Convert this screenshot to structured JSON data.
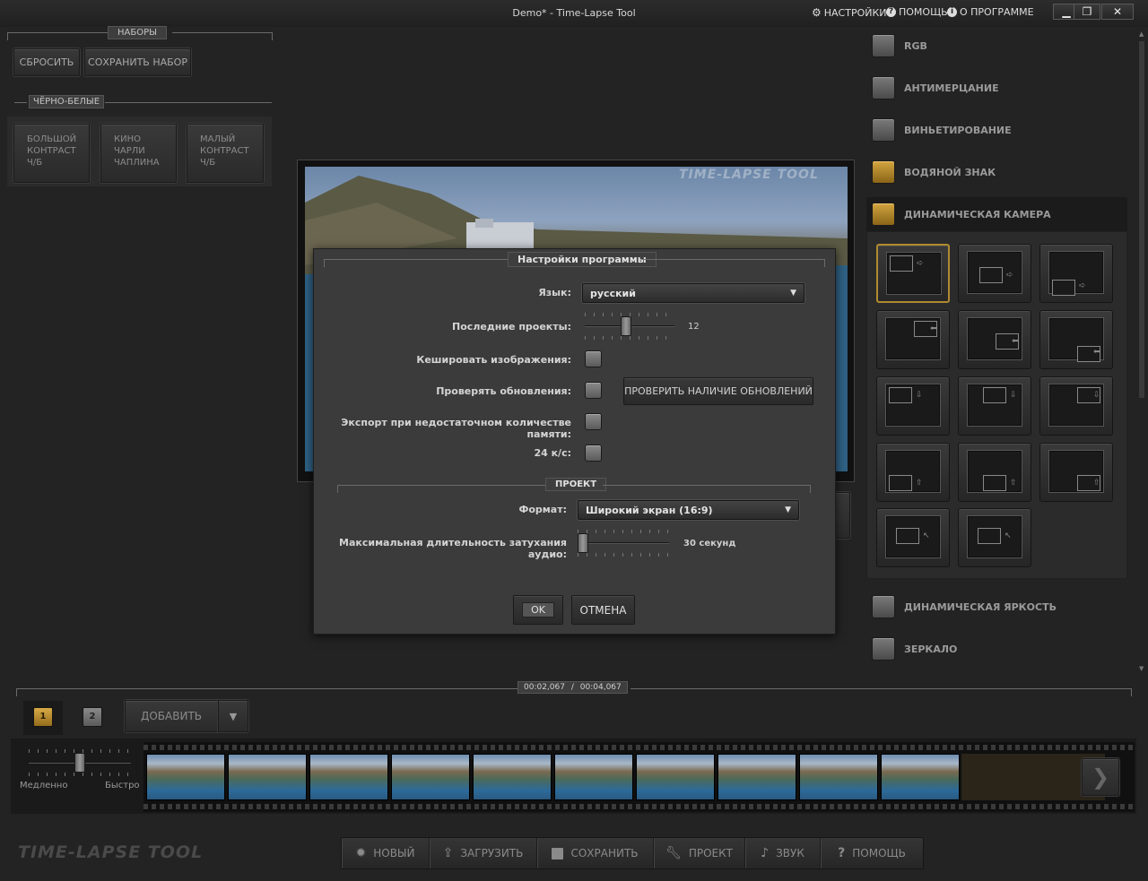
{
  "window": {
    "title": "Demo* - Time-Lapse Tool",
    "menu": {
      "settings": "НАСТРОЙКИ",
      "help": "ПОМОЩЬ",
      "about": "О ПРОГРАММЕ"
    },
    "controls": {
      "minimize": "▁",
      "restore": "❐",
      "close": "✕"
    }
  },
  "presets": {
    "heading": "НАБОРЫ",
    "reset_label": "СБРОСИТЬ",
    "save_label": "СОХРАНИТЬ НАБОР",
    "bw_heading": "ЧЁРНО-БЕЛЫЕ",
    "items": [
      {
        "label": "БОЛЬШОЙ\nКОНТРАСТ\nЧ/Б"
      },
      {
        "label": "КИНО\nЧАРЛИ\nЧАПЛИНА"
      },
      {
        "label": "МАЛЫЙ\nКОНТРАСТ\nЧ/Б"
      }
    ]
  },
  "preview": {
    "watermark": "TIME-LAPSE TOOL"
  },
  "effects": {
    "items": [
      {
        "label": "RGB",
        "on": false
      },
      {
        "label": "АНТИМЕРЦАНИЕ",
        "on": false
      },
      {
        "label": "ВИНЬЕТИРОВАНИЕ",
        "on": false
      },
      {
        "label": "ВОДЯНОЙ ЗНАК",
        "on": true
      },
      {
        "label": "ДИНАМИЧЕСКАЯ КАМЕРА",
        "on": true
      }
    ],
    "bottom_items": [
      {
        "label": "ДИНАМИЧЕСКАЯ ЯРКОСТЬ",
        "on": false
      },
      {
        "label": "ЗЕРКАЛО",
        "on": false
      }
    ],
    "camera_selected": 0
  },
  "dialog": {
    "title": "Настройки программы",
    "language_label": "Язык:",
    "language_value": "русский",
    "recent_label": "Последние проекты:",
    "recent_value": "12",
    "recent_fraction": 0.45,
    "cache_label": "Кешировать изображения:",
    "updates_label": "Проверять обновления:",
    "check_updates_button": "ПРОВЕРИТЬ НАЛИЧИЕ ОБНОВЛЕНИЙ",
    "lowmem_label": "Экспорт при недостаточном количестве памяти:",
    "fps_label": "24 к/с:",
    "project_heading": "ПРОЕКТ",
    "format_label": "Формат:",
    "format_value": "Широкий экран (16:9)",
    "fade_label": "Максимальная длительность затухания аудио:",
    "fade_value": "30 секунд",
    "fade_fraction": 0.0,
    "ok_label": "OK",
    "cancel_label": "ОТМЕНА"
  },
  "timeline": {
    "current_time": "00:02,067",
    "separator": "/",
    "total_time": "00:04,067",
    "pages": [
      "1",
      "2"
    ],
    "active_page": 0,
    "add_label": "ДОБАВИТЬ",
    "speed_slow": "Медленно",
    "speed_fast": "Быстро",
    "speed_fraction": 0.5,
    "frame_count": 10
  },
  "toolbar": {
    "logo": "TIME-LAPSE TOOL",
    "buttons": [
      {
        "id": "new",
        "label": "НОВЫЙ",
        "icon": "burst-icon"
      },
      {
        "id": "load",
        "label": "ЗАГРУЗИТЬ",
        "icon": "upload-icon"
      },
      {
        "id": "save",
        "label": "СОХРАНИТЬ",
        "icon": "floppy-icon"
      },
      {
        "id": "project",
        "label": "ПРОЕКТ",
        "icon": "wrench-icon"
      },
      {
        "id": "sound",
        "label": "ЗВУК",
        "icon": "note-icon"
      },
      {
        "id": "help",
        "label": "ПОМОЩЬ",
        "icon": "question-icon"
      }
    ]
  },
  "colors": {
    "accent": "#c8972f",
    "background": "#232323",
    "dialog": "#3b3b3b"
  }
}
